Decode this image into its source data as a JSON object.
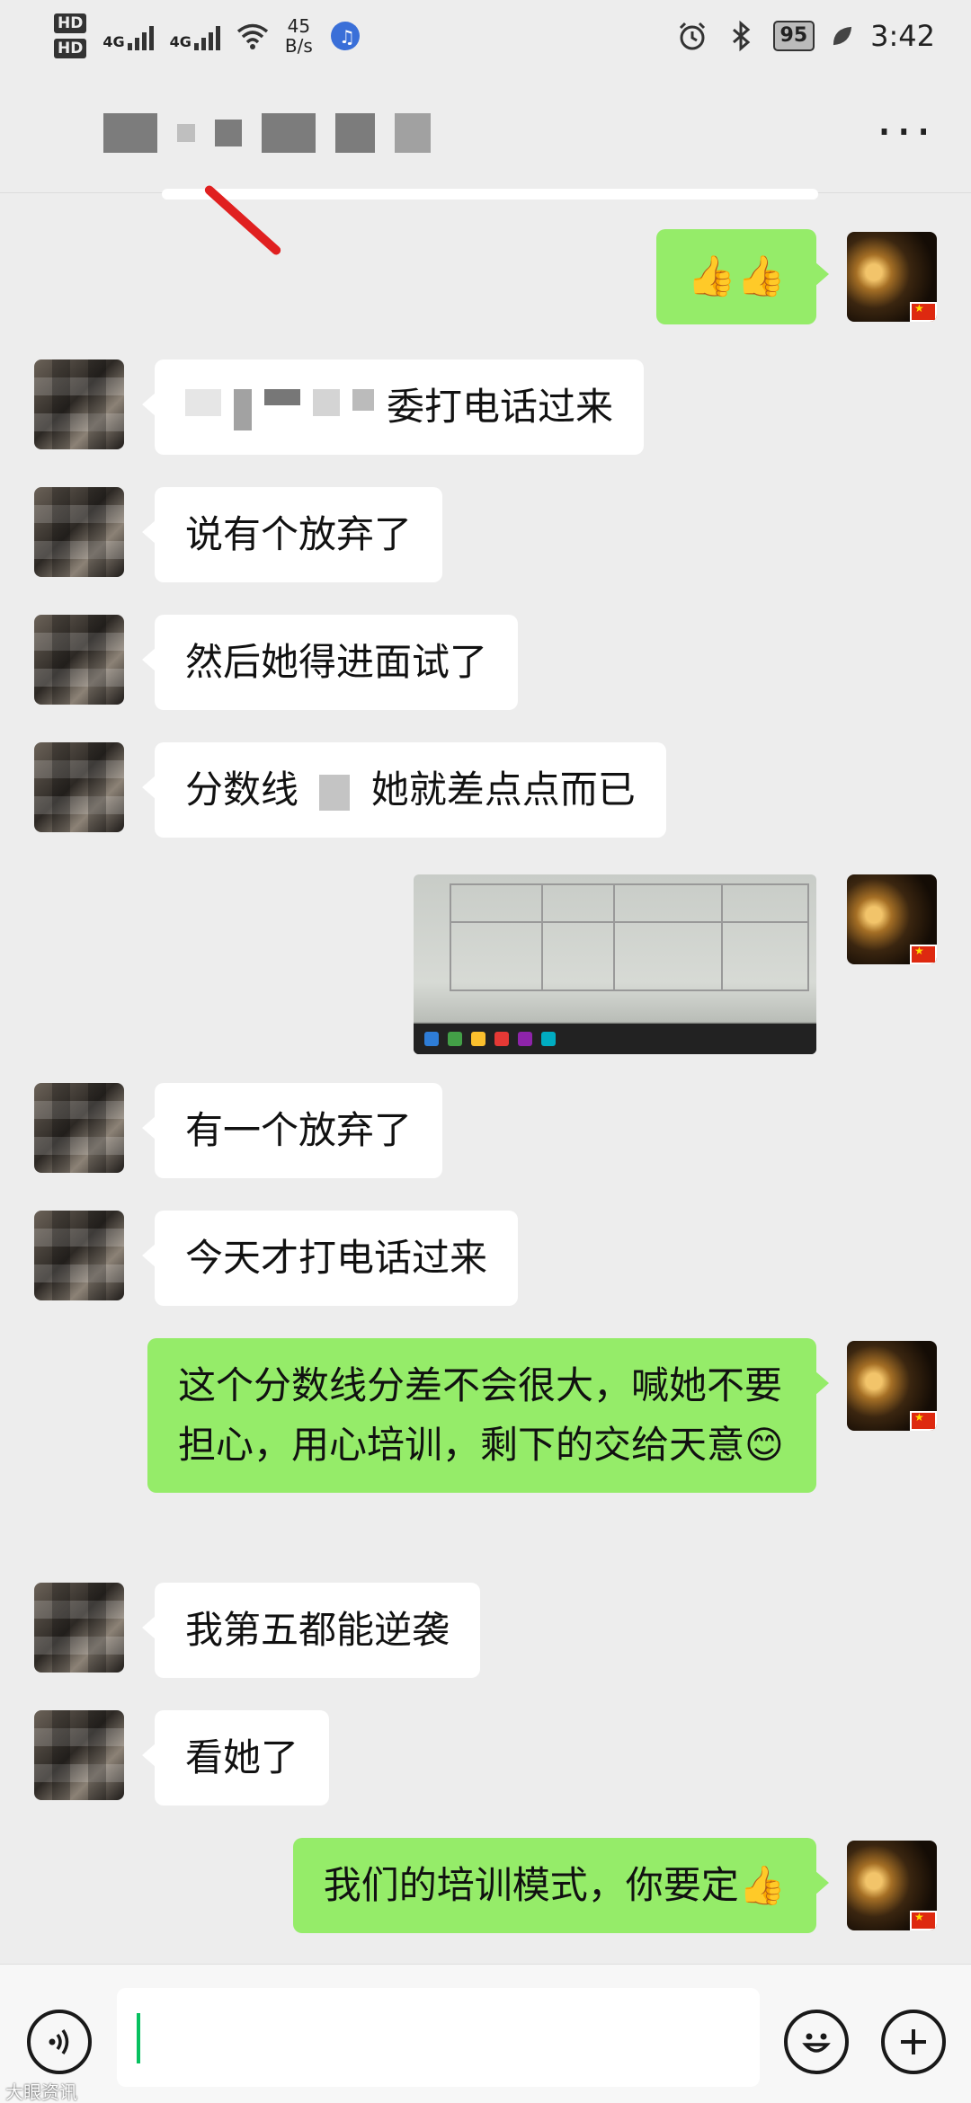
{
  "status_bar": {
    "hd1": "HD",
    "hd2": "HD",
    "net1": "4G",
    "net2": "4G",
    "net_speed_value": "45",
    "net_speed_unit": "B/s",
    "battery": "95",
    "time": "3:42"
  },
  "header": {
    "more_label": "···"
  },
  "messages": [
    {
      "side": "out",
      "text": "👍👍"
    },
    {
      "side": "in",
      "text": "委打电话过来"
    },
    {
      "side": "in",
      "text": "说有个放弃了"
    },
    {
      "side": "in",
      "text": "然后她得进面试了"
    },
    {
      "side": "in",
      "text_a": "分数线",
      "text_b": "她就差点点而已"
    },
    {
      "side": "out",
      "type": "image"
    },
    {
      "side": "in",
      "text": "有一个放弃了"
    },
    {
      "side": "in",
      "text": "今天才打电话过来"
    },
    {
      "side": "out",
      "text": "这个分数线分差不会很大，喊她不要担心，用心培训，剩下的交给天意😊"
    },
    {
      "side": "in",
      "text": "我第五都能逆袭"
    },
    {
      "side": "in",
      "text": "看她了"
    },
    {
      "side": "out",
      "text": "我们的培训模式，你要定👍"
    }
  ],
  "input": {
    "value": "",
    "placeholder": ""
  },
  "watermark": "大眼资讯",
  "colors": {
    "background": "#ededed",
    "bubble_out": "#95ec69",
    "bubble_in": "#ffffff",
    "caret": "#07c160"
  },
  "icons": {
    "voice": "voice-icon",
    "emoji": "smiley-icon",
    "plus": "plus-icon",
    "more": "more-dots-icon"
  }
}
